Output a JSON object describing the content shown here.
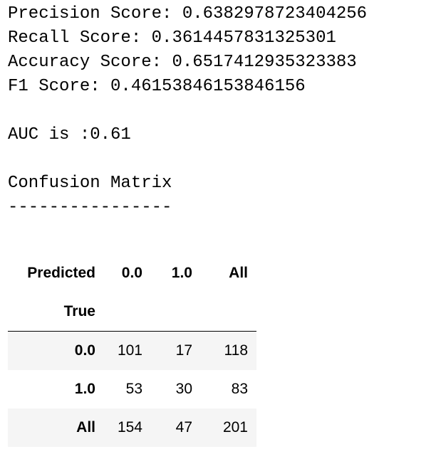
{
  "metrics": {
    "precision_line": "Precision Score: 0.6382978723404256",
    "recall_line": "Recall Score: 0.3614457831325301",
    "accuracy_line": "Accuracy Score: 0.6517412935323383",
    "f1_line": "F1 Score: 0.46153846153846156"
  },
  "auc_line": "AUC is :0.61",
  "confusion": {
    "title": "Confusion Matrix",
    "rule": "----------------",
    "columns_name": "Predicted",
    "columns": [
      "0.0",
      "1.0",
      "All"
    ],
    "index_name": "True",
    "rows": [
      {
        "label": "0.0",
        "values": [
          "101",
          "17",
          "118"
        ]
      },
      {
        "label": "1.0",
        "values": [
          "53",
          "30",
          "83"
        ]
      },
      {
        "label": "All",
        "values": [
          "154",
          "47",
          "201"
        ]
      }
    ]
  },
  "colors": {
    "stripe": "#f5f5f5",
    "text": "#000000"
  }
}
